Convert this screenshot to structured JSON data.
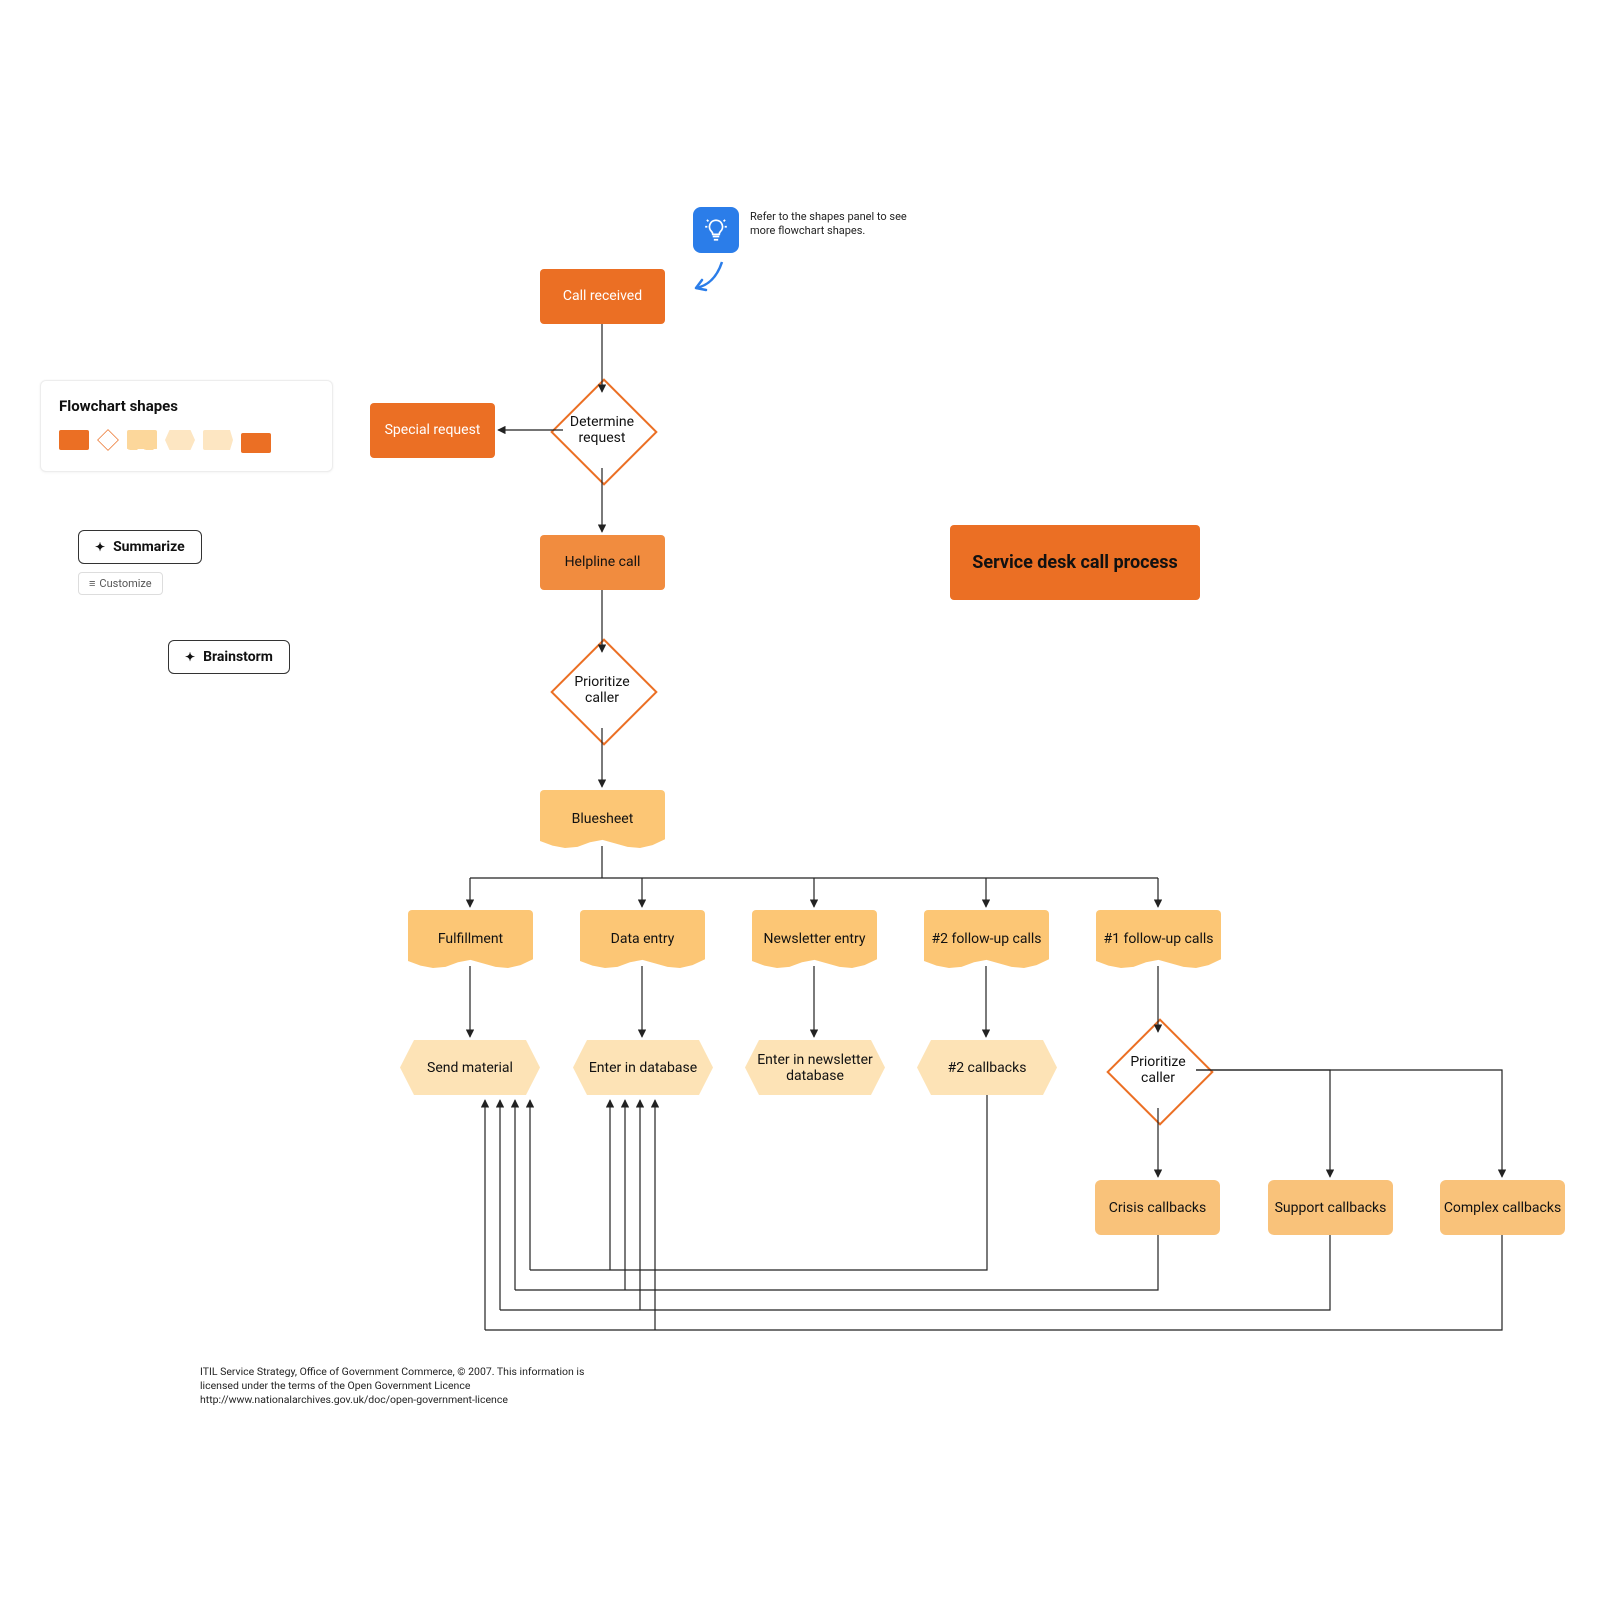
{
  "panel": {
    "title": "Flowchart shapes",
    "summarize": "Summarize",
    "customize": "Customize",
    "brainstorm": "Brainstorm"
  },
  "tip": {
    "text": "Refer to the shapes panel to see more flowchart shapes."
  },
  "nodes": {
    "call_received": "Call received",
    "determine_request": "Determine request",
    "special_request": "Special request",
    "helpline_call": "Helpline call",
    "prioritize_caller": "Prioritize caller",
    "bluesheet": "Bluesheet",
    "fulfillment": "Fulfillment",
    "data_entry": "Data entry",
    "newsletter_entry": "Newsletter entry",
    "followup2": "#2 follow-up calls",
    "followup1": "#1 follow-up calls",
    "send_material": "Send material",
    "enter_db": "Enter in database",
    "enter_news_db": "Enter in newsletter database",
    "callbacks2": "#2 callbacks",
    "prioritize_caller2": "Prioritize caller",
    "crisis": "Crisis callbacks",
    "support": "Support callbacks",
    "complex": "Complex callbacks",
    "title": "Service desk call process"
  },
  "footnote": "ITIL Service Strategy, Office of Government Commerce, © 2007. This information is licensed under the terms of the Open Government Licence http://www.nationalarchives.gov.uk/doc/open-government-licence"
}
